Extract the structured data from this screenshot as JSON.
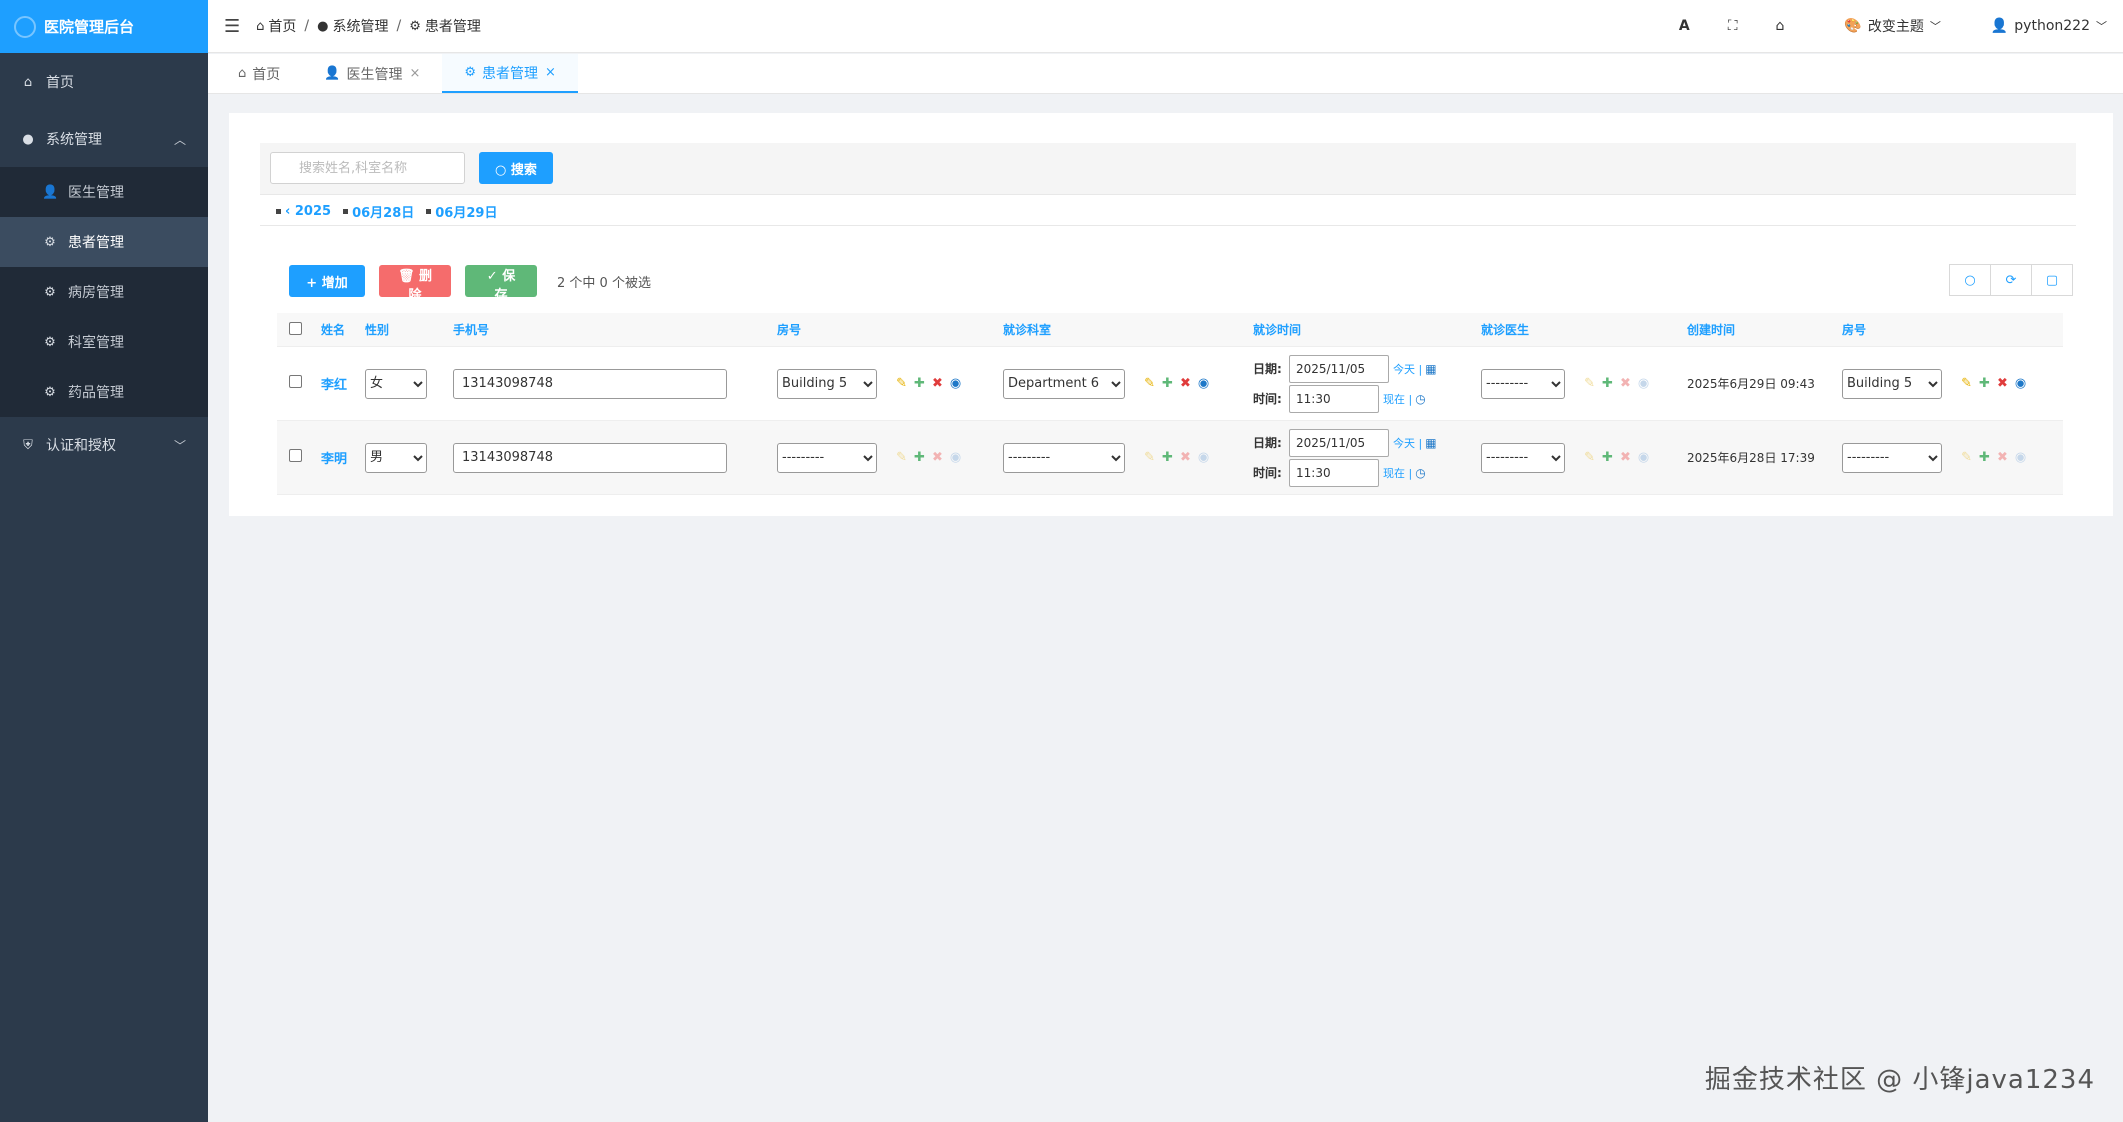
{
  "brand": "医院管理后台",
  "sidebar": {
    "home": "首页",
    "system": {
      "label": "系统管理",
      "items": [
        "医生管理",
        "患者管理",
        "病房管理",
        "科室管理",
        "药品管理"
      ]
    },
    "auth": "认证和授权"
  },
  "topbar": {
    "breadcrumb": [
      "首页",
      "系统管理",
      "患者管理"
    ],
    "theme": "改变主题",
    "user": "python222"
  },
  "tabs": [
    "首页",
    "医生管理",
    "患者管理"
  ],
  "search": {
    "placeholder": "搜索姓名,科室名称",
    "button": "搜索"
  },
  "dates": {
    "prev": "‹ 2025",
    "d1": "06月28日",
    "d2": "06月29日"
  },
  "actions": {
    "add": "增加",
    "delete": "删除",
    "save": "保存",
    "selected": "2 个中 0 个被选"
  },
  "table": {
    "headers": [
      "姓名",
      "性别",
      "手机号",
      "房号",
      "就诊科室",
      "就诊时间",
      "就诊医生",
      "创建时间",
      "房号"
    ],
    "date_label": "日期:",
    "time_label": "时间:",
    "today": "今天 |",
    "now": "现在 |",
    "rows": [
      {
        "name": "李红",
        "gender": "女",
        "phone": "13143098748",
        "room": "Building 5",
        "dept": "Department 6",
        "date": "2025/11/05",
        "time": "11:30",
        "doctor": "---------",
        "created": "2025年6月29日 09:43",
        "room2": "Building 5"
      },
      {
        "name": "李明",
        "gender": "男",
        "phone": "13143098748",
        "room": "---------",
        "dept": "---------",
        "date": "2025/11/05",
        "time": "11:30",
        "doctor": "---------",
        "created": "2025年6月28日 17:39",
        "room2": "---------"
      }
    ]
  },
  "watermark": "掘金技术社区 @ 小锋java1234"
}
